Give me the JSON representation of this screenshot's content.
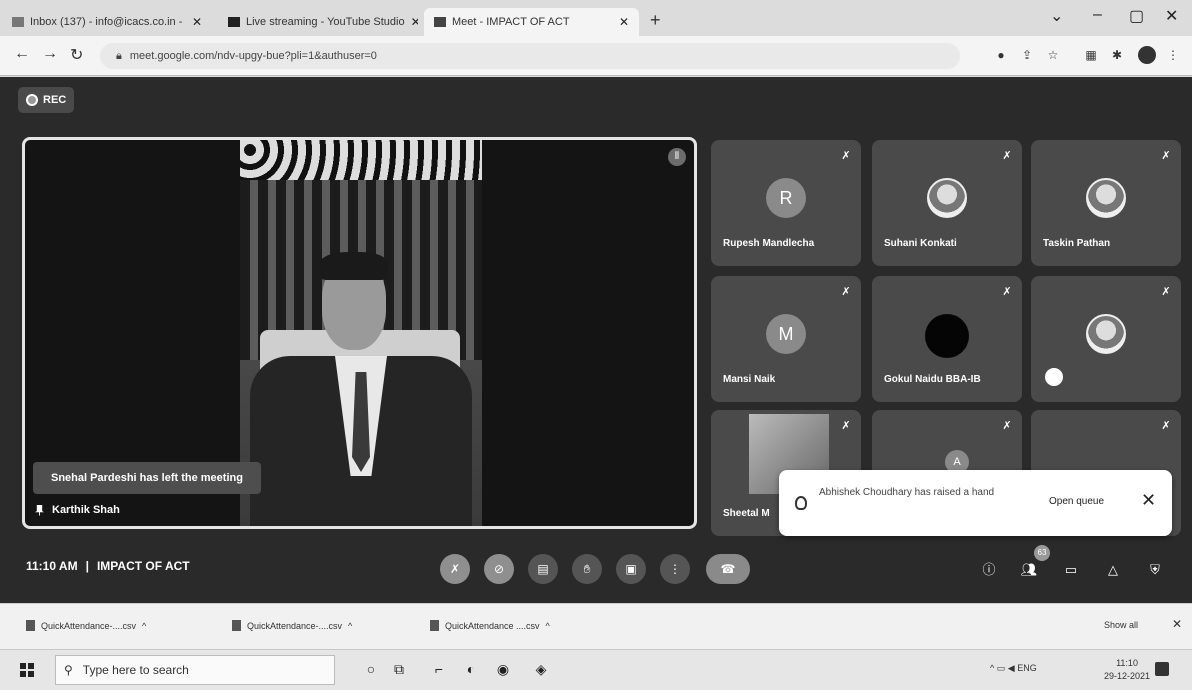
{
  "browser": {
    "tabs": [
      {
        "label": "Inbox (137) - info@icacs.co.in - "
      },
      {
        "label": "Live streaming - YouTube Studio"
      },
      {
        "label": "Meet - IMPACT OF ACT"
      }
    ],
    "url": "meet.google.com/ndv-upgy-bue?pli=1&authuser=0"
  },
  "meet": {
    "rec_label": "REC",
    "speaker": {
      "name": "Karthik Shah",
      "left_toast": "Snehal Pardeshi has left the meeting"
    },
    "participants": [
      {
        "name": "Rupesh Mandlecha",
        "avatar": "R"
      },
      {
        "name": "Suhani Konkati",
        "avatar": ""
      },
      {
        "name": "Taskin Pathan",
        "avatar": ""
      },
      {
        "name": "Mansi Naik",
        "avatar": "M"
      },
      {
        "name": "Gokul Naidu BBA-IB",
        "avatar": ""
      },
      {
        "name": "",
        "avatar": ""
      },
      {
        "name": "Sheetal M",
        "avatar": ""
      },
      {
        "name": "",
        "avatar": "A"
      },
      {
        "name": "",
        "avatar": ""
      }
    ],
    "raise_toast": {
      "message": "Abhishek Choudhary has raised a hand",
      "action": "Open queue"
    },
    "time": "11:10 AM",
    "separator": "|",
    "meeting_title": "IMPACT OF ACT",
    "people_count": "63"
  },
  "downloads": {
    "items": [
      {
        "label": "QuickAttendance-....csv"
      },
      {
        "label": "QuickAttendance-....csv"
      },
      {
        "label": "QuickAttendance ....csv"
      }
    ],
    "show_all": "Show all"
  },
  "taskbar": {
    "search_placeholder": "Type here to search",
    "lang": "ENG",
    "clock_time": "11:10",
    "clock_date": "29-12-2021"
  }
}
